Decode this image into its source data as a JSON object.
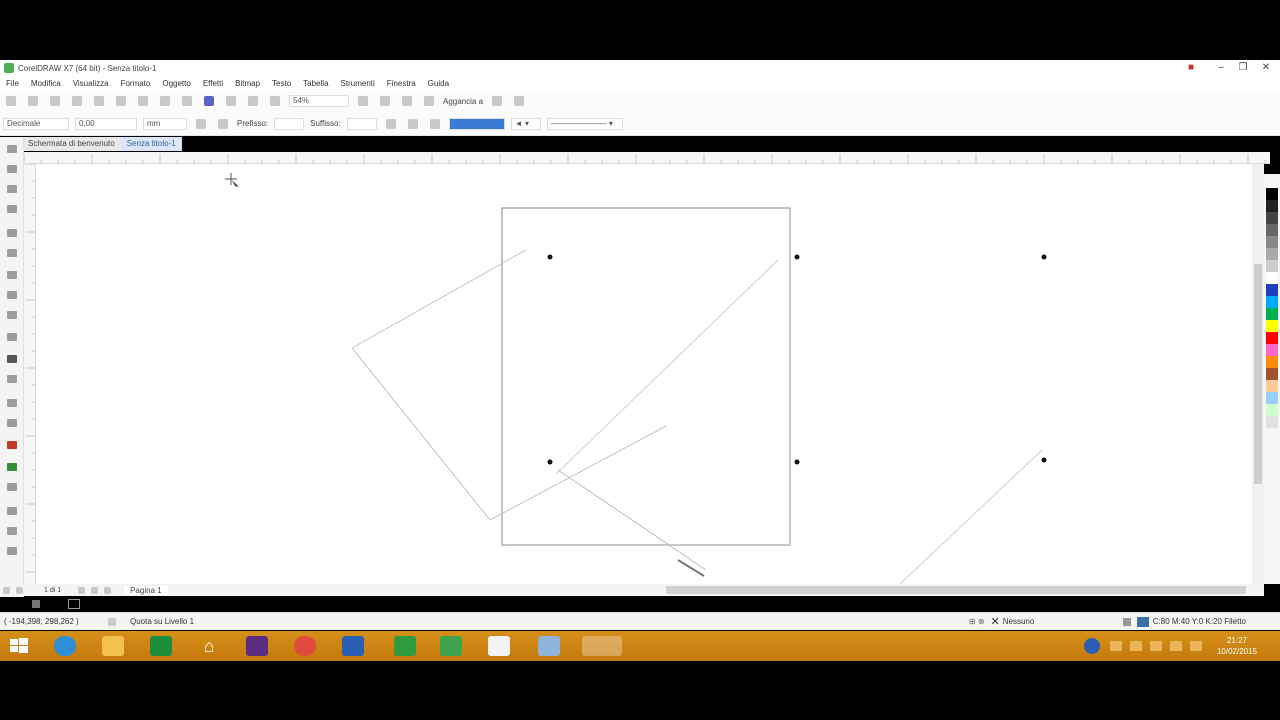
{
  "window": {
    "title": "CorelDRAW X7 (64 bit) - Senza titolo-1"
  },
  "menu": [
    "File",
    "Modifica",
    "Visualizza",
    "Formato",
    "Oggetto",
    "Effetti",
    "Bitmap",
    "Testo",
    "Tabella",
    "Strumenti",
    "Finestra",
    "Guida"
  ],
  "toolbar1": {
    "zoom": "54%",
    "snap_label": "Aggancia a"
  },
  "toolbar2": {
    "unit_type": "Decimale",
    "precision": "0,00",
    "unit": "mm",
    "prefix_label": "Prefisso:",
    "suffix_label": "Suffisso:",
    "prefix_value": "",
    "suffix_value": ""
  },
  "tabs": [
    {
      "label": "Schermata di benvenuto"
    },
    {
      "label": "Senza titolo-1"
    }
  ],
  "pager": {
    "page_count": "1 di 1",
    "page_tab": "Pagina 1"
  },
  "status": {
    "coordinates": "( -194,398; 298,262 )",
    "layer": "Quota su Livello 1",
    "fill": "Nessuno",
    "outline": "C:80 M:40 Y:0 K:20  Filetto"
  },
  "taskbar": {
    "time": "21:27",
    "date": "10/02/2015"
  },
  "colors": {
    "taskbar": "#d58f19",
    "accent": "#3a7bd5"
  },
  "palette": [
    "#000000",
    "#222222",
    "#444444",
    "#666666",
    "#888888",
    "#aaaaaa",
    "#cccccc",
    "#ffffff",
    "#1e3fbf",
    "#00aaff",
    "#00b050",
    "#ffff00",
    "#ff0000",
    "#ff66cc",
    "#ff8c00",
    "#a0522d",
    "#ffcc99",
    "#99ccff",
    "#ccffcc",
    "#e0e0e0"
  ]
}
